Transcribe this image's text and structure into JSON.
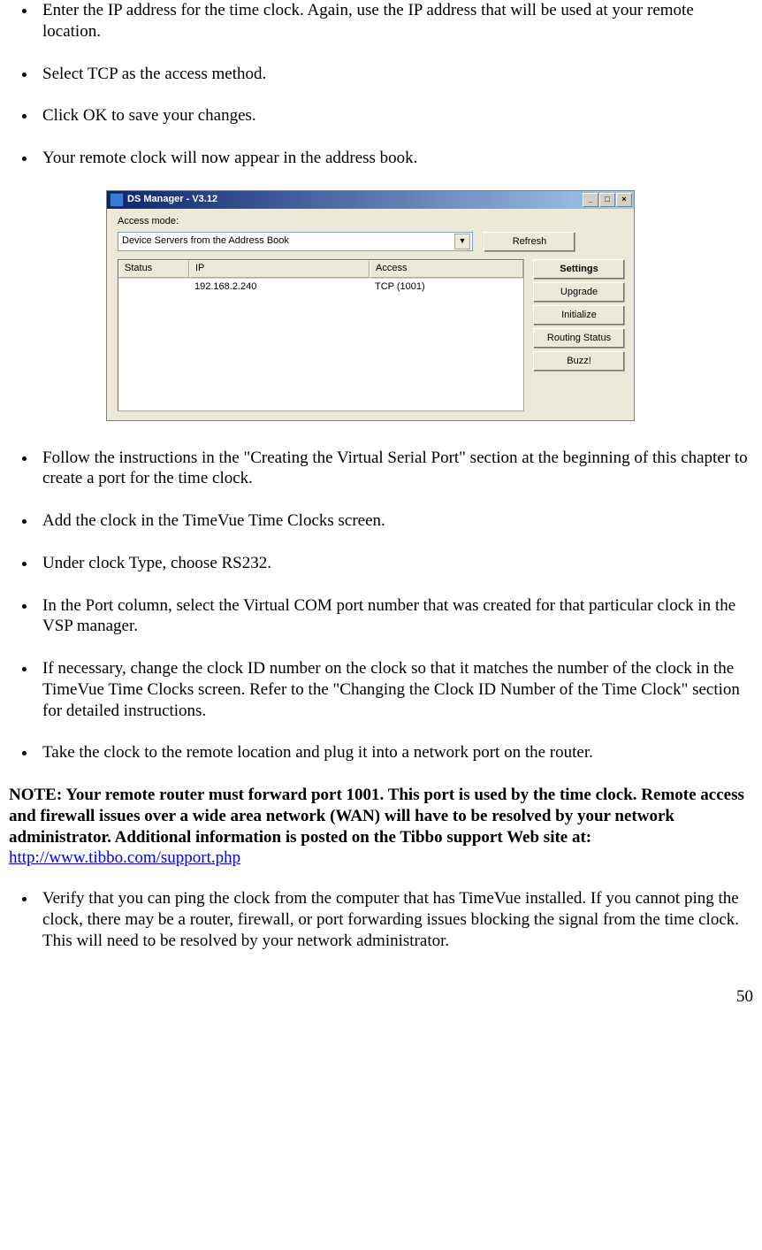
{
  "bullets_top": [
    "Enter the IP address for the time clock.  Again, use the IP address that will be used at your remote location.",
    "Select TCP as the access method.",
    "Click OK to save your changes.",
    "Your remote clock will now appear in the address book."
  ],
  "screenshot": {
    "title": "DS Manager - V3.12",
    "access_label": "Access mode:",
    "dropdown_value": "Device Servers from the Address Book",
    "refresh": "Refresh",
    "cols": {
      "status": "Status",
      "ip": "IP",
      "access": "Access"
    },
    "row": {
      "status": "",
      "ip": "192.168.2.240",
      "access": "TCP (1001)"
    },
    "buttons": {
      "settings": "Settings",
      "upgrade": "Upgrade",
      "initialize": "Initialize",
      "routing": "Routing Status",
      "buzz": "Buzz!"
    }
  },
  "bullets_mid": [
    "Follow the instructions in the \"Creating the Virtual Serial Port\" section at the beginning of this chapter to create a port for the time clock.",
    "Add the clock in the TimeVue Time Clocks screen.",
    "Under clock Type, choose RS232.",
    "In the Port column, select the Virtual COM port number that was created for that particular clock in the VSP manager.",
    "If necessary, change the clock ID number on the clock so that it matches the number of the clock in the TimeVue Time Clocks screen.  Refer to the \"Changing the Clock ID Number of the Time Clock\" section for detailed instructions.",
    "Take the clock to the remote location and plug it into a network port on the router."
  ],
  "note": {
    "text": "NOTE:  Your remote router must forward port 1001.  This port is used by the time clock.  Remote access and firewall issues over a wide area network (WAN) will have to be resolved by your network administrator.  Additional information is posted on the Tibbo support Web site at:  ",
    "link": "http://www.tibbo.com/support.php"
  },
  "bullets_bottom": [
    "Verify that you can ping the clock from the computer that has TimeVue installed.  If you cannot ping the clock, there may be a router, firewall, or port forwarding issues blocking the signal from the time clock.  This will need to be resolved by your network administrator."
  ],
  "page_number": "50"
}
